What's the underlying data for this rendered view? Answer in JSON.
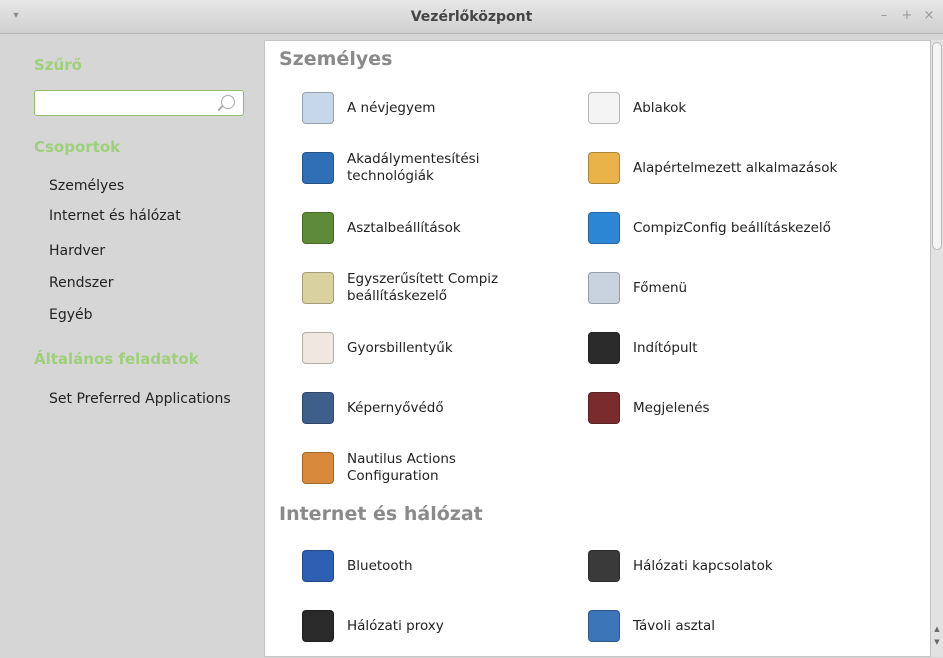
{
  "window": {
    "title": "Vezérlőközpont",
    "menu_glyph": "▾",
    "minimize_glyph": "–",
    "maximize_glyph": "+",
    "close_glyph": "×"
  },
  "sidebar": {
    "filter_heading": "Szűrő",
    "search_value": "",
    "groups_heading": "Csoportok",
    "groups": [
      "Személyes",
      "Internet és hálózat",
      "Hardver",
      "Rendszer",
      "Egyéb"
    ],
    "tasks_heading": "Általános feladatok",
    "tasks": [
      "Set Preferred Applications"
    ]
  },
  "sections": [
    {
      "title": "Személyes",
      "items": [
        {
          "label": "A névjegyem",
          "icon": "contact-card-icon",
          "color": "#c7d7ea"
        },
        {
          "label": "Ablakok",
          "icon": "window-icon",
          "color": "#f4f4f4"
        },
        {
          "label": "Akadálymentesítési\ntechnológiák",
          "icon": "accessibility-icon",
          "color": "#2f6fb5"
        },
        {
          "label": "Alapértelmezett alkalmazások",
          "icon": "default-apps-icon",
          "color": "#e9b34a"
        },
        {
          "label": "Asztalbeállítások",
          "icon": "desktop-icon",
          "color": "#5e8b3a"
        },
        {
          "label": "CompizConfig beállításkezelő",
          "icon": "compiz-icon",
          "color": "#2c86d4"
        },
        {
          "label": "Egyszerűsített Compiz\nbeállításkezelő",
          "icon": "simple-compiz-icon",
          "color": "#d9d2a0"
        },
        {
          "label": "Főmenü",
          "icon": "main-menu-icon",
          "color": "#c9d3e0"
        },
        {
          "label": "Gyorsbillentyűk",
          "icon": "keyboard-shortcuts-icon",
          "color": "#efe7e0"
        },
        {
          "label": "Indítópult",
          "icon": "launcher-icon",
          "color": "#2b2b2b"
        },
        {
          "label": "Képernyővédő",
          "icon": "screensaver-icon",
          "color": "#3e5f8a"
        },
        {
          "label": "Megjelenés",
          "icon": "appearance-icon",
          "color": "#7a2b2b"
        },
        {
          "label": "Nautilus Actions\nConfiguration",
          "icon": "nautilus-actions-icon",
          "color": "#d88a3a"
        }
      ]
    },
    {
      "title": "Internet és hálózat",
      "items": [
        {
          "label": "Bluetooth",
          "icon": "bluetooth-icon",
          "color": "#2d5fb3"
        },
        {
          "label": "Hálózati kapcsolatok",
          "icon": "network-connections-icon",
          "color": "#3a3a3a"
        },
        {
          "label": "Hálózati proxy",
          "icon": "network-proxy-icon",
          "color": "#2a2a2a"
        },
        {
          "label": "Távoli asztal",
          "icon": "remote-desktop-icon",
          "color": "#3d76b8"
        }
      ]
    }
  ]
}
